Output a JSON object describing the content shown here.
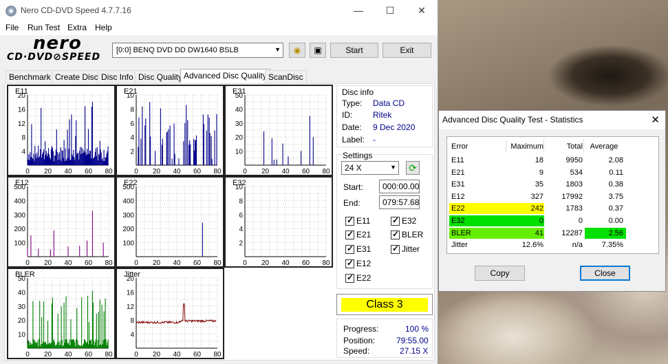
{
  "window": {
    "title": "Nero CD-DVD Speed 4.7.7.16"
  },
  "menu": [
    "File",
    "Run Test",
    "Extra",
    "Help"
  ],
  "logo": {
    "line1": "nero",
    "line2": "CD·DVD⊘SPEED"
  },
  "drive": "[0:0]   BENQ DVD DD DW1640 BSLB",
  "buttons": {
    "start": "Start",
    "exit": "Exit"
  },
  "tabs": [
    "Benchmark",
    "Create Disc",
    "Disc Info",
    "Disc Quality",
    "Advanced Disc Quality",
    "ScanDisc"
  ],
  "disc_info": {
    "title": "Disc info",
    "type_label": "Type:",
    "type": "Data CD",
    "id_label": "ID:",
    "id": "Ritek",
    "date_label": "Date:",
    "date": "9 Dec 2020",
    "label_label": "Label:",
    "label": "-"
  },
  "settings": {
    "title": "Settings",
    "speed": "24 X",
    "start_label": "Start:",
    "start": "000:00.00",
    "end_label": "End:",
    "end": "079:57.68",
    "checks": [
      "E11",
      "E32",
      "E21",
      "BLER",
      "E31",
      "Jitter",
      "E12",
      "E22"
    ]
  },
  "class": "Class 3",
  "progress": {
    "progress_label": "Progress:",
    "progress": "100 %",
    "position_label": "Position:",
    "position": "79:55.00",
    "speed_label": "Speed:",
    "speed": "27.15 X"
  },
  "stats_dialog": {
    "title": "Advanced Disc Quality Test - Statistics",
    "headers": [
      "Error",
      "Maximum",
      "Total",
      "Average"
    ],
    "rows": [
      [
        "E11",
        "18",
        "9950",
        "2.08"
      ],
      [
        "E21",
        "9",
        "534",
        "0.11"
      ],
      [
        "E31",
        "35",
        "1803",
        "0.38"
      ],
      [
        "E12",
        "327",
        "17992",
        "3.75"
      ],
      [
        "E22",
        "242",
        "1783",
        "0.37"
      ],
      [
        "E32",
        "0",
        "0",
        "0.00"
      ],
      [
        "BLER",
        "41",
        "12287",
        "2.56"
      ],
      [
        "Jitter",
        "12.6%",
        "n/a",
        "7.35%"
      ]
    ],
    "copy": "Copy",
    "close": "Close"
  },
  "colors": {
    "bar": "#00008b",
    "e12": "#800080",
    "bler": "#008000",
    "jitter": "#800000",
    "yellow": "#ffff00",
    "green": "#00e000",
    "lightgreen": "#66ee00"
  },
  "chart_data": [
    {
      "type": "bar",
      "title": "E11",
      "ylim": [
        0,
        20
      ],
      "yticks": [
        "20",
        "16",
        "12",
        "8",
        "4"
      ],
      "xticks": [
        "0",
        "20",
        "40",
        "60",
        "80"
      ],
      "color": "#00008b",
      "density": "dense",
      "max": 18,
      "avg": 2.08
    },
    {
      "type": "bar",
      "title": "E21",
      "ylim": [
        0,
        10
      ],
      "yticks": [
        "10",
        "8",
        "6",
        "4",
        "2"
      ],
      "xticks": [
        "0",
        "20",
        "40",
        "60",
        "80"
      ],
      "color": "#00008b",
      "density": "medium",
      "max": 9,
      "avg": 0.11
    },
    {
      "type": "bar",
      "title": "E31",
      "ylim": [
        0,
        50
      ],
      "yticks": [
        "50",
        "40",
        "30",
        "20",
        "10"
      ],
      "xticks": [
        "0",
        "20",
        "40",
        "60",
        "80"
      ],
      "color": "#00008b",
      "density": "sparse",
      "max": 35,
      "avg": 0.38
    },
    {
      "type": "bar",
      "title": "E12",
      "ylim": [
        0,
        500
      ],
      "yticks": [
        "500",
        "400",
        "300",
        "200",
        "100"
      ],
      "xticks": [
        "0",
        "20",
        "40",
        "60",
        "80"
      ],
      "color": "#800080",
      "density": "sparse",
      "max": 327,
      "avg": 3.75
    },
    {
      "type": "bar",
      "title": "E22",
      "ylim": [
        0,
        500
      ],
      "yticks": [
        "500",
        "400",
        "300",
        "200",
        "100"
      ],
      "xticks": [
        "0",
        "20",
        "40",
        "60",
        "80"
      ],
      "color": "#00008b",
      "density": "single",
      "max": 242,
      "avg": 0.37
    },
    {
      "type": "bar",
      "title": "E32",
      "ylim": [
        0,
        10
      ],
      "yticks": [
        "10",
        "8",
        "6",
        "4",
        "2"
      ],
      "xticks": [
        "0",
        "20",
        "40",
        "60",
        "80"
      ],
      "color": "#00008b",
      "density": "none",
      "max": 0,
      "avg": 0
    },
    {
      "type": "bar",
      "title": "BLER",
      "ylim": [
        0,
        50
      ],
      "yticks": [
        "50",
        "40",
        "30",
        "20",
        "10"
      ],
      "xticks": [
        "0",
        "20",
        "40",
        "60",
        "80"
      ],
      "color": "#008000",
      "density": "dense",
      "max": 41,
      "avg": 2.56
    },
    {
      "type": "line",
      "title": "Jitter",
      "ylim": [
        0,
        20
      ],
      "yticks": [
        "20",
        "16",
        "12",
        "8",
        "4"
      ],
      "xticks": [
        "0",
        "20",
        "40",
        "60",
        "80"
      ],
      "color": "#800000",
      "max": 12.6,
      "avg": 7.35
    }
  ]
}
